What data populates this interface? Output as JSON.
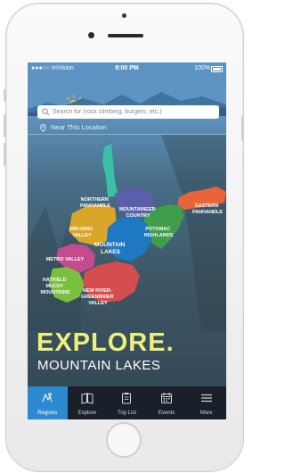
{
  "status_bar": {
    "carrier": "●●●○○ InVision",
    "time": "8:00 PM",
    "battery": "100%"
  },
  "search": {
    "placeholder": "Search for (rock climbing, burgers, etc.)"
  },
  "near_location": "Near This Location",
  "regions": {
    "northern_panhandle": [
      "NORTHERN",
      "PANHANDLE"
    ],
    "mountaineer_country": [
      "MOUNTAINEER",
      "COUNTRY"
    ],
    "eastern_panhandle": [
      "EASTERN",
      "PANHANDLE"
    ],
    "mid_ohio_valley": [
      "MID-OHIO",
      "VALLEY"
    ],
    "potomac_highlands": [
      "POTOMAC",
      "HIGHLANDS"
    ],
    "mountain_lakes": [
      "MOUNTAIN",
      "LAKES"
    ],
    "metro_valley": [
      "METRO VALLEY"
    ],
    "hatfield_mccoy": [
      "HATFIELD",
      "McCOY",
      "MOUNTAINS"
    ],
    "new_river_greenbrier": [
      "NEW RIVER-",
      "GREENBRIER",
      "VALLEY"
    ]
  },
  "headline": "EXPLORE.",
  "subheadline": "MOUNTAIN LAKES",
  "tabs": [
    {
      "label": "Regions",
      "icon": "map-pin-icon",
      "active": true
    },
    {
      "label": "Explore",
      "icon": "book-icon",
      "active": false
    },
    {
      "label": "Trip List",
      "icon": "clipboard-icon",
      "active": false
    },
    {
      "label": "Events",
      "icon": "calendar-icon",
      "active": false
    },
    {
      "label": "More",
      "icon": "menu-icon",
      "active": false
    }
  ],
  "colors": {
    "accent_active_tab": "#2e8ad0",
    "headline": "#eef07a",
    "northern_panhandle": "#3bbfa7",
    "mountaineer_country": "#5b5ea8",
    "eastern_panhandle": "#e8643a",
    "mid_ohio_valley": "#d9a62a",
    "potomac_highlands": "#3e9e4c",
    "mountain_lakes": "#1f78c2",
    "metro_valley": "#c54b8f",
    "hatfield_mccoy": "#7bbf3e",
    "new_river_greenbrier": "#d64d4d"
  }
}
